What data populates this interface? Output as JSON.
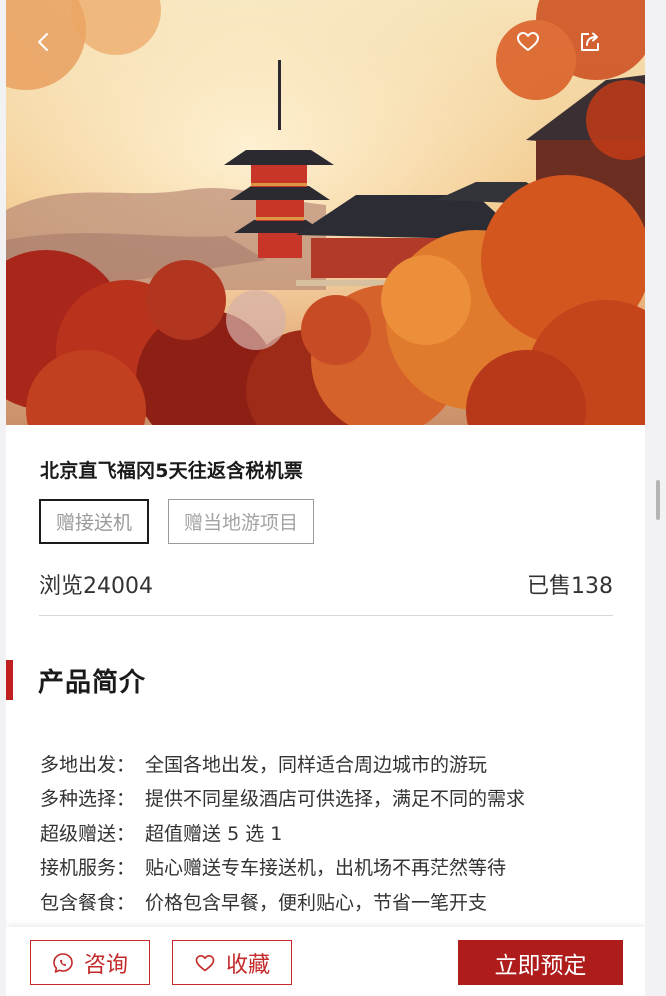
{
  "hero": {
    "image": "Red pagoda and temple among autumn maple leaves at sunset",
    "back_icon": "chevron-left-icon",
    "like_icon": "heart-outline-icon",
    "share_icon": "share-icon"
  },
  "product": {
    "title": "北京直飞福冈5天往返含税机票",
    "tags": [
      "赠接送机",
      "赠当地游项目"
    ],
    "views": "浏览24004",
    "sold": "已售138"
  },
  "section": {
    "title": "产品简介"
  },
  "features": [
    {
      "key": "多地出发",
      "value": "全国各地出发，同样适合周边城市的游玩"
    },
    {
      "key": "多种选择",
      "value": "提供不同星级酒店可供选择，满足不同的需求"
    },
    {
      "key": "超级赠送",
      "value": "超值赠送 5 选 1"
    },
    {
      "key": "接机服务",
      "value": "贴心赠送专车接送机，出机场不再茫然等待"
    },
    {
      "key": "包含餐食",
      "value": "价格包含早餐，便利贴心，节省一笔开支"
    }
  ],
  "bottom_bar": {
    "consult_label": "咨询",
    "favorite_label": "收藏",
    "book_label": "立即预定"
  },
  "colors": {
    "accent": "#c42a2a",
    "book_bg": "#ae1c1c",
    "section_bar": "#c11f1f"
  }
}
